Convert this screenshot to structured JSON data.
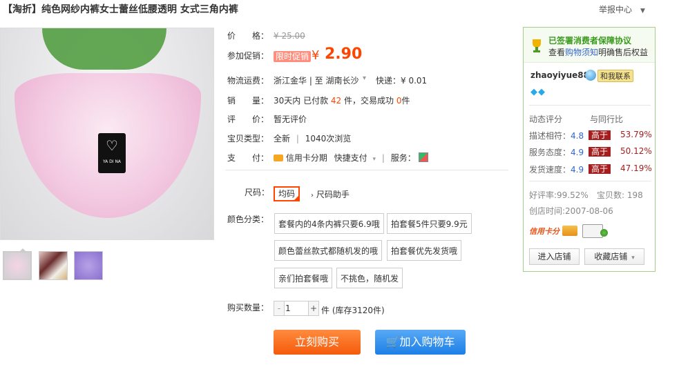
{
  "title": "【淘折】纯色网纱内裤女士蕾丝低腰透明 女式三角内裤",
  "report": "举报中心",
  "product_image": {
    "tag_brand": "YA DI NA"
  },
  "price": {
    "label": "价　　格：",
    "original": "¥ 25.00",
    "promo_label": "参加促销：",
    "promo_badge": "限时促销",
    "currency": "¥",
    "value": "2.90"
  },
  "logistics": {
    "label": "物流运费：",
    "route": "浙江金华 | 至  湖南长沙",
    "dropdown": "▾",
    "express": "快递：¥ 0.01"
  },
  "sales": {
    "label": "销　　量：",
    "text1": "30天内 已付款",
    "paid": "42",
    "text2": "件，交易成功",
    "success": "0",
    "text3": "件"
  },
  "review": {
    "label": "评　　价：",
    "value": "暂无评价"
  },
  "item_type": {
    "label": "宝贝类型：",
    "condition": "全新",
    "views": "1040次浏览"
  },
  "payment": {
    "label": "支　　付：",
    "credit": "信用卡分期",
    "quick": "快捷支付",
    "service_label": "服务："
  },
  "size": {
    "label": "尺码：",
    "selected": "均码",
    "helper": "尺码助手"
  },
  "color": {
    "label": "颜色分类：",
    "options": [
      "套餐内的4条内裤只要6.9哦",
      "拍套餐5件只要9.9元",
      "颜色蕾丝款式都随机发的哦",
      "拍套餐优先发货哦",
      "亲们拍套餐哦",
      "不挑色，随机发"
    ]
  },
  "quantity": {
    "label": "购买数量：",
    "value": "1",
    "unit": "件 (库存3120件)"
  },
  "buttons": {
    "buy": "立刻购买",
    "cart": "加入购物车"
  },
  "seller": {
    "guarantee_title": "已签署消费者保障协议",
    "notice_prefix": "查看",
    "notice_link": "购物须知",
    "notice_suffix": "明确售后权益",
    "name": "zhaoyiyue88",
    "chat": "和我联系",
    "diamonds": "◆◆",
    "rating_header": "动态评分",
    "compare_header": "与同行比",
    "ratings": [
      {
        "label": "描述相符：",
        "score": "4.8",
        "compare": "高于",
        "pct": "53.79%"
      },
      {
        "label": "服务态度：",
        "score": "4.9",
        "compare": "高于",
        "pct": "50.12%"
      },
      {
        "label": "发货速度：",
        "score": "4.9",
        "compare": "高于",
        "pct": "47.19%"
      }
    ],
    "good_rate": "好评率:99.52%",
    "item_count": "宝贝数: 198",
    "created": "创店时间:2007-08-06",
    "credit_logo": "信用卡分",
    "enter_shop": "进入店铺",
    "fav_shop": "收藏店铺"
  }
}
